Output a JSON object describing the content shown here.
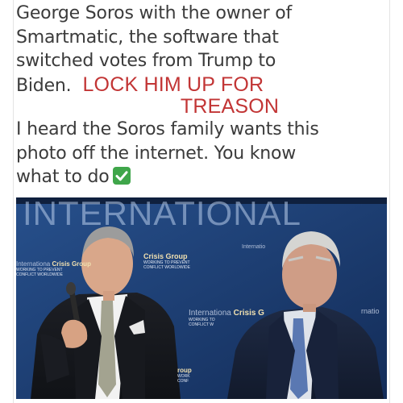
{
  "post": {
    "lines": [
      "George Soros with the owner of",
      "Smartmatic, the software that",
      "switched votes from Trump to",
      "Biden."
    ],
    "caps_part1": "LOCK HIM UP FOR",
    "caps_part2": "TREASON",
    "lines2": [
      "I heard the Soros family wants this",
      "photo off the internet. You know",
      "what to do"
    ],
    "check_icon": "check-mark-button-emoji"
  },
  "photo": {
    "backdrop_text": "INTERNATIONAL",
    "logos": [
      {
        "lead": "Internationa",
        "name": "Crisis Group",
        "sub": [
          "WORKING TO PREVENT",
          "CONFLICT WORLDWIDE"
        ]
      },
      {
        "lead": "",
        "name": "Crisis Group",
        "sub": [
          "WORKING TO PREVENT",
          "CONFLICT WORLDWIDE"
        ]
      },
      {
        "lead": "Internationa",
        "name": "Crisis G",
        "sub": [
          "WORKING TO",
          "CONFLICT W"
        ]
      },
      {
        "lead": "Internatio",
        "name": "",
        "sub": []
      },
      {
        "lead": "",
        "name": "rnatio",
        "sub": []
      },
      {
        "lead": "",
        "name": "roup",
        "sub": [
          "WORK",
          "CONF"
        ]
      }
    ],
    "colors": {
      "backdrop": "#1c3d72",
      "logo_text": "#f0e0b0"
    }
  },
  "colors": {
    "body_text": "#3b3b3b",
    "accent_red": "#c23535",
    "check_green": "#3fa64a"
  }
}
